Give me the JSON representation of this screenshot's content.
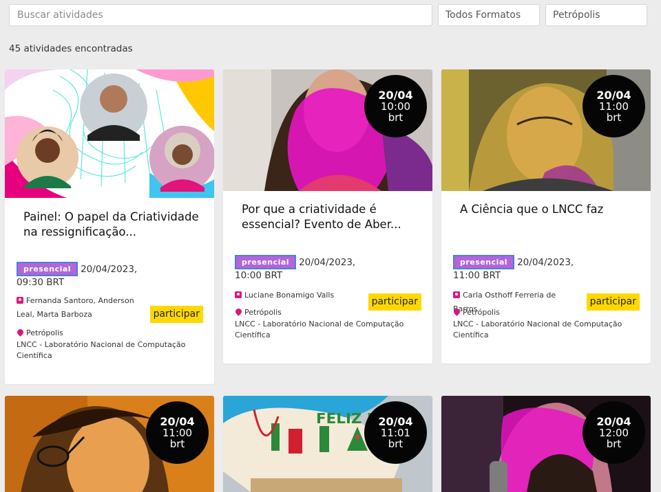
{
  "filters": {
    "search_placeholder": "Buscar atividades",
    "format_selected": "Todos Formatos",
    "city_selected": "Petrópolis"
  },
  "result_count": "45 atividades encontradas",
  "colors": {
    "badge_bg": "#050505",
    "tag_bg": "#b266d8",
    "tag_border": "#4b7de2",
    "accent_pink": "#e0147a",
    "button_bg": "#ffd800"
  },
  "cards": [
    {
      "title": "Painel: O papel da Criatividade na ressignificação...",
      "tag": "presencial",
      "datetime": "20/04/2023, 09:30 BRT",
      "people": "Fernanda Santoro, Anderson Leal, Marta Barboza",
      "city": "Petrópolis",
      "venue": "LNCC - Laboratório Nacional de Computação Científica",
      "button": "participar"
    },
    {
      "badge": {
        "date": "20/04",
        "time": "10:00",
        "tz": "brt"
      },
      "title": "Por que a criatividade é essencial? Evento de Aber...",
      "tag": "presencial",
      "datetime": "20/04/2023, 10:00 BRT",
      "people": "Luciane Bonamigo Valls",
      "city": "Petrópolis",
      "venue": "LNCC - Laboratório Nacional de Computação Científica",
      "button": "participar"
    },
    {
      "badge": {
        "date": "20/04",
        "time": "11:00",
        "tz": "brt"
      },
      "title": "A Ciência que o LNCC faz",
      "tag": "presencial",
      "datetime": "20/04/2023, 11:00 BRT",
      "people": "Carla Osthoff Ferreria de Barros",
      "city": "Petrópolis",
      "venue": "LNCC - Laboratório Nacional de Computação Científica",
      "button": "participar"
    },
    {
      "badge": {
        "date": "20/04",
        "time": "11:00",
        "tz": "brt"
      }
    },
    {
      "badge": {
        "date": "20/04",
        "time": "11:01",
        "tz": "brt"
      },
      "image_text": "FELIZ NATAL"
    },
    {
      "badge": {
        "date": "20/04",
        "time": "12:00",
        "tz": "brt"
      }
    }
  ]
}
